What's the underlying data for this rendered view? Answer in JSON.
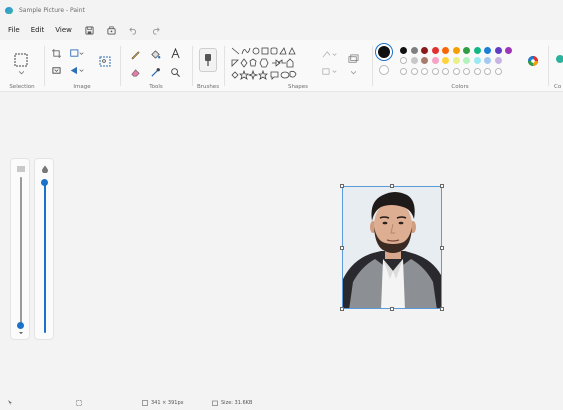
{
  "window": {
    "title": "Sample Picture - Paint"
  },
  "menu": {
    "file": "File",
    "edit": "Edit",
    "view": "View"
  },
  "ribbon": {
    "selection_label": "Selection",
    "image_label": "Image",
    "tools_label": "Tools",
    "brushes_label": "Brushes",
    "shapes_label": "Shapes",
    "colors_label": "Colors",
    "copilot_label_partial": "Co"
  },
  "palette": {
    "primary": "#111111",
    "secondary": "#ffffff",
    "row1": [
      "#111111",
      "#7f7f7f",
      "#8b1a1a",
      "#e03131",
      "#f76707",
      "#f59f00",
      "#2f9e44",
      "#12b886",
      "#1c7ed6",
      "#5f3dc4",
      "#9c36b5"
    ],
    "row2": [
      "#ffffff",
      "#c8c8c8",
      "#a67c6d",
      "#f7a1c4",
      "#ffd43b",
      "#e9f08a",
      "#b2f2bb",
      "#99e9f2",
      "#a5c8f0",
      "#c8b6e2"
    ]
  },
  "status": {
    "position": "",
    "selection_size": "",
    "image_size": "341 × 391px",
    "file_size": "Size: 31.6KB"
  },
  "colors": {
    "accent": "#1a73c9",
    "selection_border": "#5a9bd8"
  }
}
